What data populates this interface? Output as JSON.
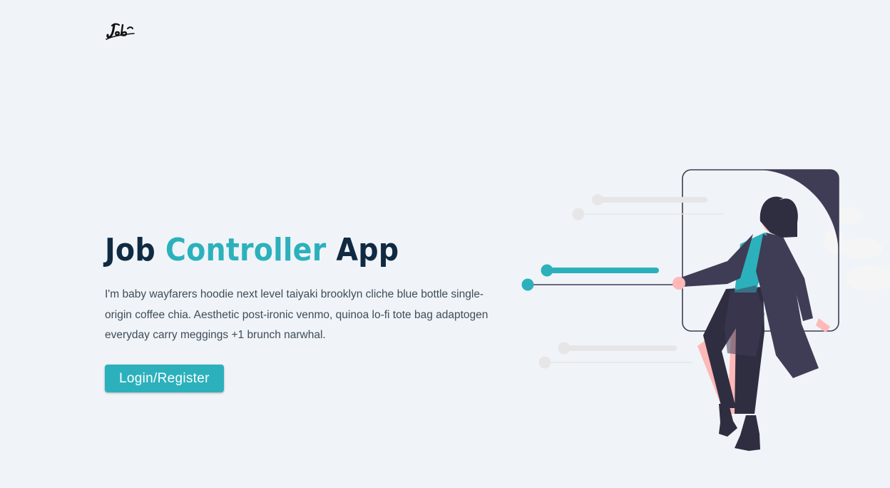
{
  "navbar": {
    "logo_icon": "script-jobs-logo-icon"
  },
  "hero": {
    "title_part1": "Job",
    "title_accent": "Controller",
    "title_part3": "App",
    "description": "I'm baby wayfarers hoodie next level taiyaki brooklyn cliche blue bottle single-origin coffee chia. Aesthetic post-ironic venmo, quinoa lo-fi tote bag adaptogen everyday carry meggings +1 brunch narwhal.",
    "cta_label": "Login/Register"
  },
  "illustration": {
    "icon": "woman-pulling-sliders-illustration"
  },
  "colors": {
    "background": "#f0f4f8",
    "primary": "#2cb1bc",
    "heading": "#102a42",
    "body_text": "#3e4c59",
    "figure_dark": "#3f3d56"
  }
}
